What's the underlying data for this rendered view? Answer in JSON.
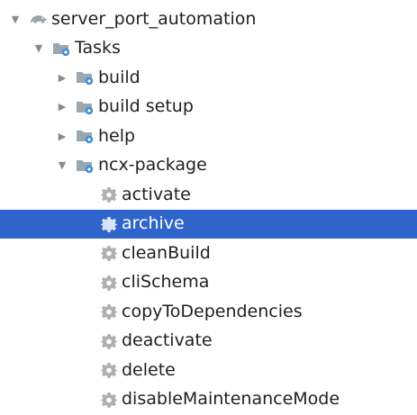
{
  "tree": {
    "root": {
      "label": "server_port_automation",
      "expanded": true,
      "icon": "elephant-icon"
    },
    "tasks": {
      "label": "Tasks",
      "expanded": true,
      "icon": "task-folder-icon"
    },
    "groups": [
      {
        "label": "build",
        "expanded": false,
        "icon": "task-folder-icon"
      },
      {
        "label": "build setup",
        "expanded": false,
        "icon": "task-folder-icon"
      },
      {
        "label": "help",
        "expanded": false,
        "icon": "task-folder-icon"
      },
      {
        "label": "ncx-package",
        "expanded": true,
        "icon": "task-folder-icon"
      }
    ],
    "ncx_tasks": [
      {
        "label": "activate",
        "selected": false,
        "icon": "gear-icon"
      },
      {
        "label": "archive",
        "selected": true,
        "icon": "gear-icon"
      },
      {
        "label": "cleanBuild",
        "selected": false,
        "icon": "gear-icon"
      },
      {
        "label": "cliSchema",
        "selected": false,
        "icon": "gear-icon"
      },
      {
        "label": "copyToDependencies",
        "selected": false,
        "icon": "gear-icon"
      },
      {
        "label": "deactivate",
        "selected": false,
        "icon": "gear-icon"
      },
      {
        "label": "delete",
        "selected": false,
        "icon": "gear-icon"
      },
      {
        "label": "disableMaintenanceMode",
        "selected": false,
        "icon": "gear-icon"
      }
    ]
  },
  "colors": {
    "selection": "#2f65ca",
    "folder": "#9aa7b0",
    "folder_gear": "#3d8fd6",
    "gear": "#b0b0b0"
  }
}
